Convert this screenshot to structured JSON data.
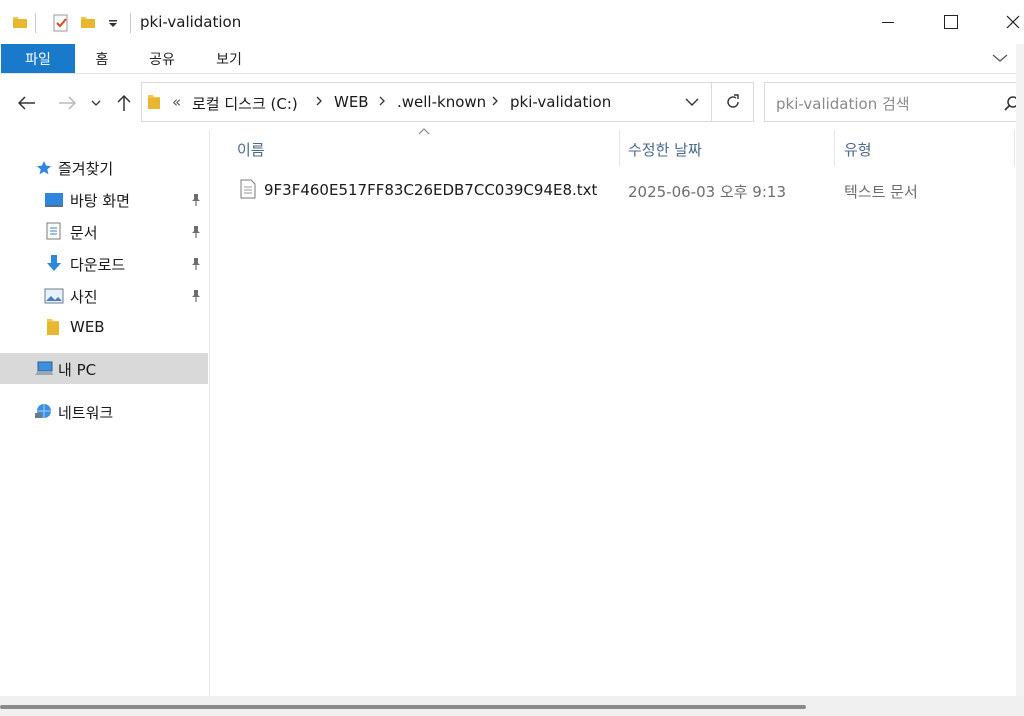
{
  "window": {
    "title": "pki-validation"
  },
  "ribbon": {
    "tabs": [
      "파일",
      "홈",
      "공유",
      "보기"
    ]
  },
  "address": {
    "overflow": "«",
    "crumbs": [
      "로컬 디스크 (C:)",
      "WEB",
      ".well-known",
      "pki-validation"
    ]
  },
  "search": {
    "placeholder": "pki-validation 검색"
  },
  "nav": {
    "quick_access": "즐겨찾기",
    "items": [
      "바탕 화면",
      "문서",
      "다운로드",
      "사진",
      "WEB"
    ],
    "this_pc": "내 PC",
    "network": "네트워크"
  },
  "columns": [
    "이름",
    "수정한 날짜",
    "유형"
  ],
  "files": [
    {
      "name": "9F3F460E517FF83C26EDB7CC039C94E8.txt",
      "modified": "2025-06-03 오후 9:13",
      "type": "텍스트 문서"
    }
  ],
  "colors": {
    "accent": "#1979ca",
    "selection": "#d9d9d9",
    "folder": "#f4c84a"
  },
  "icons": [
    "folder-icon",
    "checkmark-doc-icon",
    "dropdown-arrow-icon",
    "minimize-icon",
    "maximize-icon",
    "close-icon",
    "back-arrow-icon",
    "forward-arrow-icon",
    "up-arrow-icon",
    "refresh-icon",
    "search-icon",
    "star-icon",
    "desktop-icon",
    "document-icon",
    "download-icon",
    "pictures-icon",
    "pc-icon",
    "network-icon",
    "pin-icon",
    "text-file-icon"
  ]
}
